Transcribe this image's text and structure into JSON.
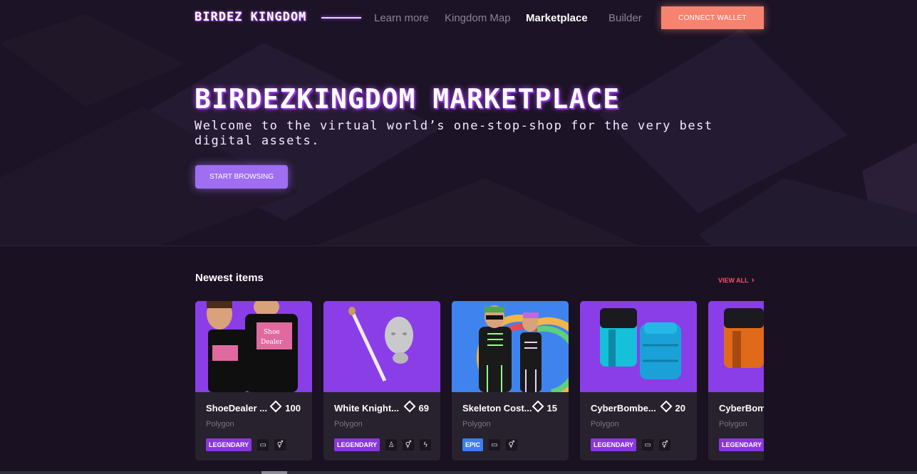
{
  "nav": {
    "logo": "BIRDEZ KINGDOM",
    "links": [
      "Learn more",
      "Kingdom Map",
      "Marketplace",
      "Builder"
    ],
    "active": "Marketplace",
    "connect_label": "CONNECT WALLET"
  },
  "hero": {
    "title": "BIRDEZKINGDOM MARKETPLACE",
    "subtitle": "Welcome to the virtual world’s one-stop-shop for the very best digital assets.",
    "cta": "START BROWSING"
  },
  "section": {
    "title": "Newest items",
    "view_all": "VIEW ALL"
  },
  "items": [
    {
      "name": "ShoeDealer ...",
      "price": "100",
      "network": "Polygon",
      "rarity": "LEGENDARY",
      "icons": [
        "wearable-icon",
        "gender-icon"
      ]
    },
    {
      "name": "White Knight...",
      "price": "69",
      "network": "Polygon",
      "rarity": "LEGENDARY",
      "icons": [
        "earring-icon",
        "gender-icon",
        "lightning-icon"
      ]
    },
    {
      "name": "Skeleton Cost...",
      "price": "15",
      "network": "Polygon",
      "rarity": "EPIC",
      "icons": [
        "wearable-icon",
        "gender-icon"
      ]
    },
    {
      "name": "CyberBombe...",
      "price": "20",
      "network": "Polygon",
      "rarity": "LEGENDARY",
      "icons": [
        "wearable-icon",
        "gender-icon"
      ]
    },
    {
      "name": "CyberBomb",
      "price": "",
      "network": "Polygon",
      "rarity": "LEGENDARY",
      "icons": []
    }
  ],
  "colors": {
    "accent_coral": "#f58370",
    "accent_purple": "#9f6ef2",
    "legendary": "#8a36e0",
    "epic": "#3b7ef0",
    "view_all": "#ff4d6a"
  }
}
